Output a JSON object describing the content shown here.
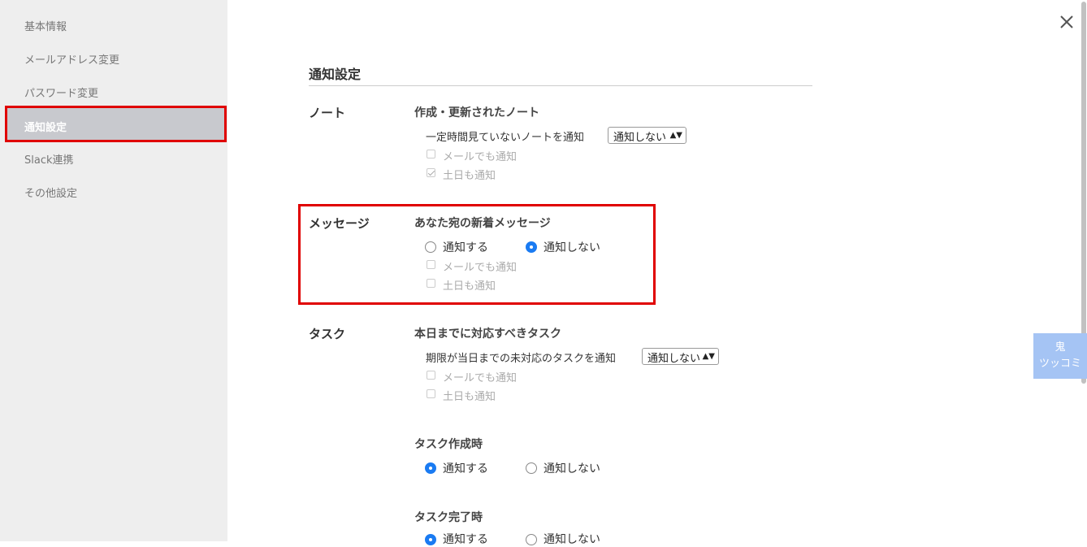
{
  "sidebar": {
    "items": [
      {
        "label": "基本情報"
      },
      {
        "label": "メールアドレス変更"
      },
      {
        "label": "パスワード変更"
      },
      {
        "label": "通知設定"
      },
      {
        "label": "Slack連携"
      },
      {
        "label": "その他設定"
      }
    ]
  },
  "page": {
    "title": "通知設定"
  },
  "note": {
    "label": "ノート",
    "subtitle": "作成・更新されたノート",
    "row_text": "一定時間見ていないノートを通知",
    "select_value": "通知しない",
    "email_label": "メールでも通知",
    "weekend_label": "土日も通知"
  },
  "message": {
    "label": "メッセージ",
    "subtitle": "あなた宛の新着メッセージ",
    "on_label": "通知する",
    "off_label": "通知しない",
    "email_label": "メールでも通知",
    "weekend_label": "土日も通知"
  },
  "task": {
    "label": "タスク",
    "subtitle": "本日までに対応すべきタスク",
    "row_text": "期限が当日までの未対応のタスクを通知",
    "select_value": "通知しない",
    "email_label": "メールでも通知",
    "weekend_label": "土日も通知",
    "created_title": "タスク作成時",
    "created_on": "通知する",
    "created_off": "通知しない",
    "completed_title": "タスク完了時",
    "completed_on": "通知する",
    "completed_off": "通知しない"
  },
  "widget": {
    "line1": "鬼",
    "line2": "ツッコミ"
  },
  "colors": {
    "accent": "#1a7bf2",
    "highlight": "#e00000",
    "widget": "#a5c4f4"
  }
}
